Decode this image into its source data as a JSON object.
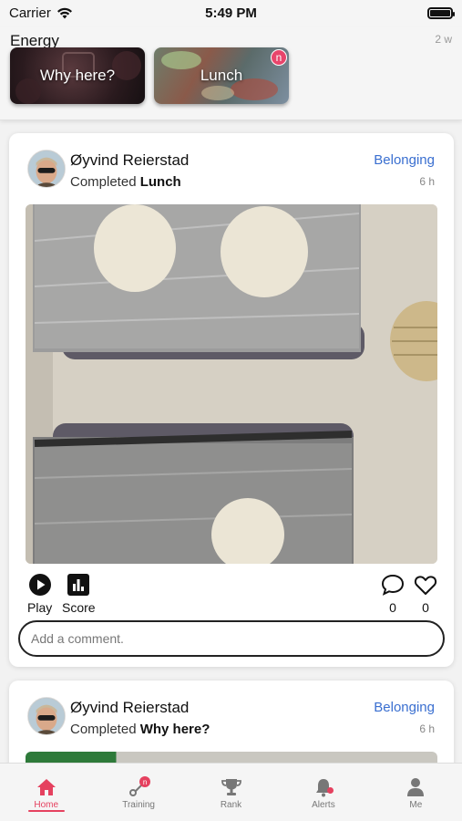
{
  "status_bar": {
    "carrier": "Carrier",
    "time": "5:49 PM"
  },
  "stories": {
    "title": "Energy",
    "age": "2 w",
    "items": [
      {
        "label": "Why here?"
      },
      {
        "label": "Lunch",
        "badge": "n"
      }
    ]
  },
  "posts": [
    {
      "user": "Øyvind Reierstad",
      "completed_prefix": "Completed",
      "activity": "Lunch",
      "category": "Belonging",
      "time": "6 h",
      "actions": {
        "play": "Play",
        "score": "Score",
        "comments": "0",
        "likes": "0"
      },
      "comment_placeholder": "Add a comment."
    },
    {
      "user": "Øyvind Reierstad",
      "completed_prefix": "Completed",
      "activity": "Why here?",
      "category": "Belonging",
      "time": "6 h"
    }
  ],
  "tabbar": {
    "items": [
      {
        "label": "Home",
        "icon": "home-icon",
        "active": true
      },
      {
        "label": "Training",
        "icon": "training-icon",
        "badge": "n"
      },
      {
        "label": "Rank",
        "icon": "trophy-icon"
      },
      {
        "label": "Alerts",
        "icon": "bell-icon"
      },
      {
        "label": "Me",
        "icon": "person-icon"
      }
    ]
  },
  "colors": {
    "accent": "#e5415f",
    "category": "#3a6fd0"
  }
}
